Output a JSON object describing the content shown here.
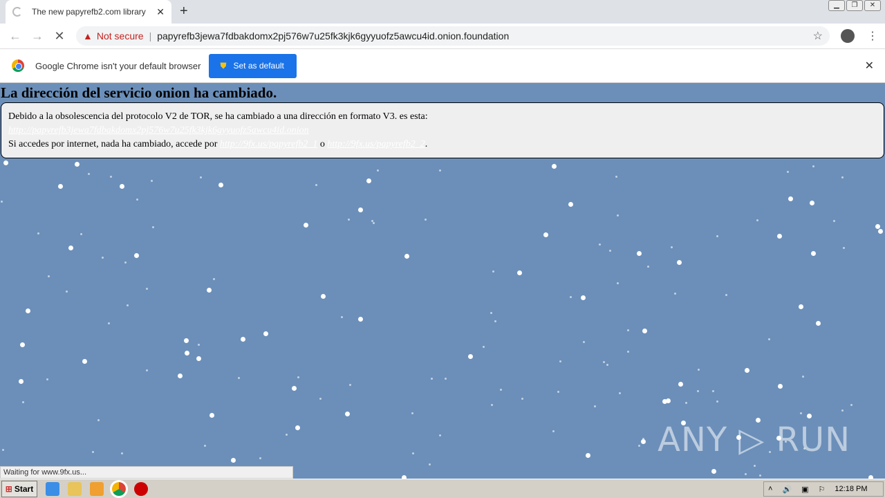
{
  "browser": {
    "tab_title": "The new papyrefb2.com library",
    "not_secure": "Not secure",
    "url": "papyrefb3jewa7fdbakdomx2pj576w7u25fk3kjk6gyyuofz5awcu4id.onion.foundation",
    "infobar_text": "Google Chrome isn't your default browser",
    "set_default_label": "Set as default",
    "status_text": "Waiting for www.9fx.us..."
  },
  "page": {
    "heading": "La dirección del servicio onion ha cambiado.",
    "line1": "Debido a la obsolescencia del protocolo V2 de TOR, se ha cambiado a una dirección en formato V3. es esta:",
    "onion_link": "http://papyrefb3jewa7fdbakdomx2pj576w7u25fk3kjk6gyyuofz5awcu4id.onion",
    "line3_prefix": "Si accedes por internet, nada ha cambiado, accede por",
    "link1": "http://9fx.us/papyrefb2_1",
    "or": "o",
    "link2": "http://9fx.us/papyrefb2_2",
    "line3_suffix": ".",
    "background_color": "#6b8fb9"
  },
  "watermark": "ANY RUN",
  "taskbar": {
    "start_label": "Start",
    "clock": "12:18 PM"
  }
}
